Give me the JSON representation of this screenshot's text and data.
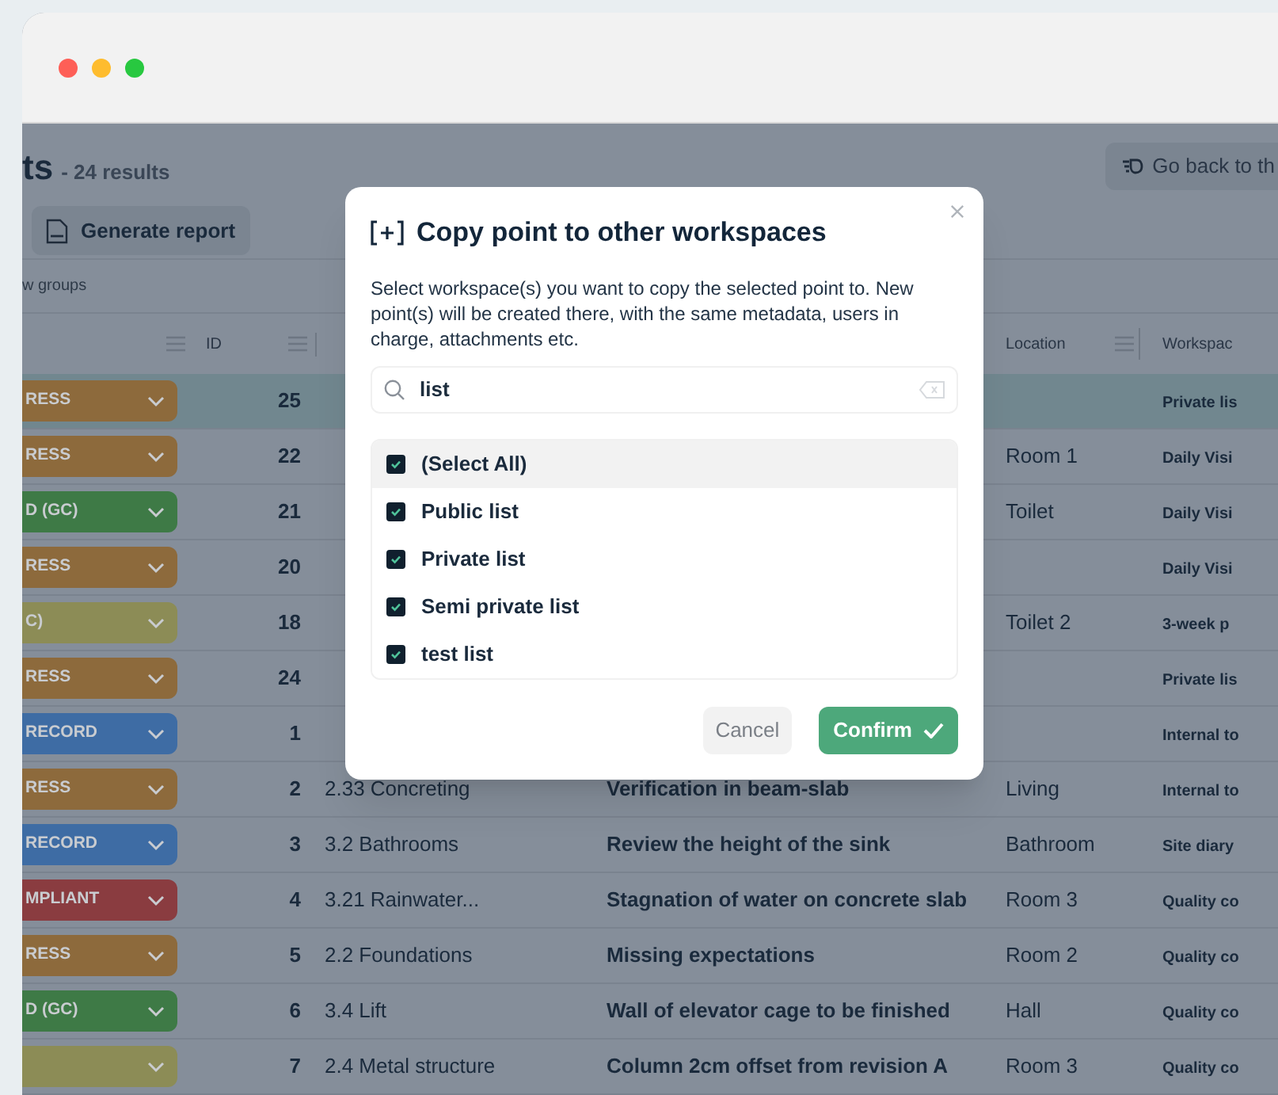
{
  "page": {
    "title": "ts",
    "result_count": "- 24 results",
    "back_button": "Go back to th",
    "report_button": "Generate report",
    "groups_hint": "w groups"
  },
  "table": {
    "headers": {
      "id": "ID",
      "location": "Location",
      "workspace": "Workspac"
    },
    "rows": [
      {
        "status": "RESS",
        "color": "#8d6a3c",
        "id": "25",
        "location": "",
        "workspace": "Private lis",
        "selected": true
      },
      {
        "status": "RESS",
        "color": "#8d6a3c",
        "id": "22",
        "location": "Room 1",
        "workspace": "Daily Visi",
        "selected": false
      },
      {
        "status": "D (GC)",
        "color": "#3e7a46",
        "id": "21",
        "location": "Toilet",
        "workspace": "Daily Visi",
        "selected": false
      },
      {
        "status": "RESS",
        "color": "#8d6a3c",
        "id": "20",
        "location": "",
        "workspace": "Daily Visi",
        "selected": false
      },
      {
        "status": "C)",
        "color": "#8c8c56",
        "id": "18",
        "location": "Toilet 2",
        "workspace": "3-week p",
        "selected": false
      },
      {
        "status": "RESS",
        "color": "#8d6a3c",
        "id": "24",
        "location": "",
        "workspace": "Private lis",
        "selected": false
      },
      {
        "status": "RECORD",
        "color": "#3e6ca4",
        "id": "1",
        "location": "",
        "workspace": "Internal to",
        "selected": false
      },
      {
        "status": "RESS",
        "color": "#8d6a3c",
        "id": "2",
        "code": "2.33 Concreting",
        "title": "Verification in beam-slab",
        "location": "Living",
        "workspace": "Internal to",
        "selected": false
      },
      {
        "status": "RECORD",
        "color": "#3e6ca4",
        "id": "3",
        "code": "3.2 Bathrooms",
        "title": "Review the height of the sink",
        "location": "Bathroom",
        "workspace": "Site diary",
        "selected": false
      },
      {
        "status": "MPLIANT",
        "color": "#8a3c40",
        "id": "4",
        "code": "3.21 Rainwater...",
        "title": "Stagnation of water on concrete slab",
        "location": "Room 3",
        "workspace": "Quality co",
        "selected": false
      },
      {
        "status": "RESS",
        "color": "#8d6a3c",
        "id": "5",
        "code": "2.2 Foundations",
        "title": "Missing expectations",
        "location": "Room 2",
        "workspace": "Quality co",
        "selected": false
      },
      {
        "status": "D (GC)",
        "color": "#3e7a46",
        "id": "6",
        "code": "3.4 Lift",
        "title": "Wall of elevator cage to be finished",
        "location": "Hall",
        "workspace": "Quality co",
        "selected": false
      },
      {
        "status": "",
        "color": "#8c8c56",
        "id": "7",
        "code": "2.4 Metal structure",
        "title": "Column 2cm offset from revision A",
        "location": "Room 3",
        "workspace": "Quality co",
        "selected": false
      }
    ]
  },
  "modal": {
    "title": "Copy point to other workspaces",
    "description": "Select workspace(s) you want to copy the selected point to. New point(s) will be created there, with the same metadata, users in charge, attachments etc.",
    "search_value": "list",
    "options": [
      {
        "label": "(Select All)",
        "checked": true,
        "hovered": true
      },
      {
        "label": "Public list",
        "checked": true,
        "hovered": false
      },
      {
        "label": "Private list",
        "checked": true,
        "hovered": false
      },
      {
        "label": "Semi private list",
        "checked": true,
        "hovered": false
      },
      {
        "label": "test list",
        "checked": true,
        "hovered": false
      }
    ],
    "cancel": "Cancel",
    "confirm": "Confirm"
  }
}
